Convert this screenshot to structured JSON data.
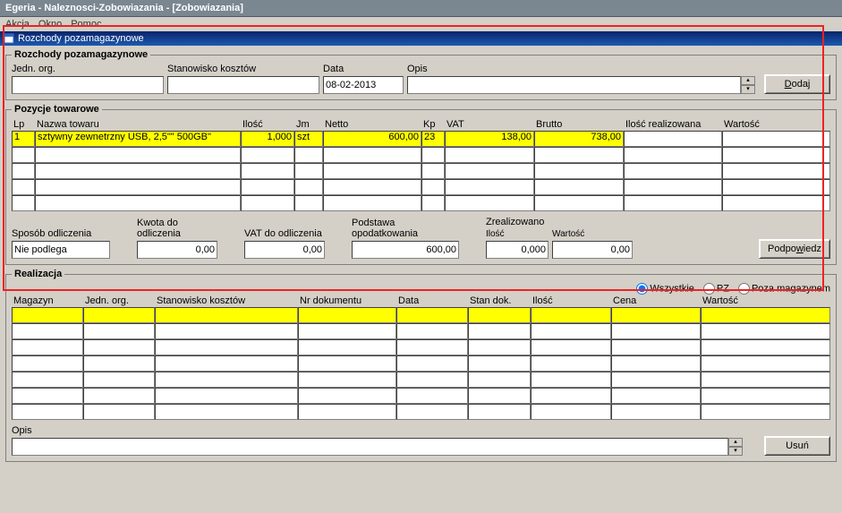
{
  "titlebar": "Egeria - Naleznosci-Zobowiazania - [Zobowiazania]",
  "menu": {
    "akcja": "Akcja",
    "okno": "Okno",
    "pomoc": "Pomoc"
  },
  "mdi_title": "Rozchody pozamagazynowe",
  "section1": {
    "legend": "Rozchody pozamagazynowe",
    "jedn_org_label": "Jedn. org.",
    "stanowisko_label": "Stanowisko kosztów",
    "data_label": "Data",
    "data_value": "08-02-2013",
    "opis_label": "Opis",
    "dodaj": "Dodaj"
  },
  "section2": {
    "legend": "Pozycje towarowe",
    "headers": {
      "lp": "Lp",
      "nazwa": "Nazwa towaru",
      "ilosc": "Ilość",
      "jm": "Jm",
      "netto": "Netto",
      "kp": "Kp",
      "vat": "VAT",
      "brutto": "Brutto",
      "ilosc_real": "Ilość realizowana",
      "wartosc": "Wartość"
    },
    "row1": {
      "lp": "1",
      "nazwa": "sztywny zewnetrzny USB, 2,5\"\" 500GB\"",
      "ilosc": "1,000",
      "jm": "szt",
      "netto": "600,00",
      "kp": "23",
      "vat": "138,00",
      "brutto": "738,00",
      "ilosc_real": "",
      "wartosc": ""
    },
    "calc": {
      "sposob_label": "Sposób odliczenia",
      "sposob_value": "Nie podlega",
      "kwota_label": "Kwota do odliczenia",
      "kwota_value": "0,00",
      "vatdo_label": "VAT do odliczenia",
      "vatdo_value": "0,00",
      "podstawa_label": "Podstawa opodatkowania",
      "podstawa_value": "600,00",
      "zrealizowano_label": "Zrealizowano",
      "zreal_ilosc_label": "Ilość",
      "zreal_ilosc_value": "0,000",
      "zreal_wartosc_label": "Wartość",
      "zreal_wartosc_value": "0,00",
      "podpowiedz": "Podpowiedz"
    }
  },
  "section3": {
    "legend": "Realizacja",
    "radios": {
      "wszystkie": "Wszystkie",
      "pz": "PZ",
      "poza": "Poza magazynem"
    },
    "headers": {
      "mag": "Magazyn",
      "jedn": "Jedn. org.",
      "stan": "Stanowisko kosztów",
      "nrdok": "Nr dokumentu",
      "data": "Data",
      "standok": "Stan dok.",
      "ilosc": "Ilość",
      "cena": "Cena",
      "wartosc": "Wartość"
    },
    "opis_label": "Opis",
    "usun": "Usuń"
  }
}
